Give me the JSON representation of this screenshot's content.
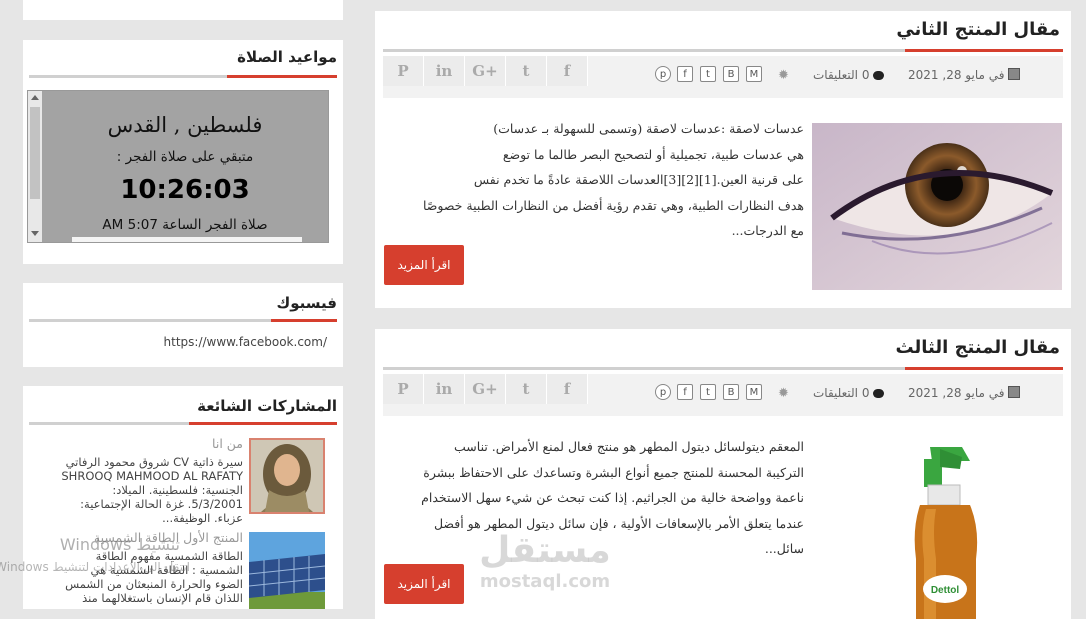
{
  "sidebar": {
    "prayer": {
      "title": "مواعيد الصلاة",
      "city": "فلسطين , القدس",
      "remaining_label": "متبقي على صلاة الفجر :",
      "countdown": "10:26:03",
      "next_prayer": "صلاة الفجر الساعة 5:07 AM"
    },
    "facebook": {
      "title": "فيسبوك",
      "link": "https://www.facebook.com/"
    },
    "popular": {
      "title": "المشاركات الشائعة",
      "items": [
        {
          "title": "من انا",
          "line1": "سيرة ذاتية CV شروق محمود الرفاتي",
          "line2": "SHROOQ MAHMOOD AL RAFATY",
          "line3": "الجنسية:   فلسطينية. الميلاد:",
          "line4": "5/3/2001.   غزة الحالة الإجتماعية:",
          "line5": "عزباء.     الوظيفة..."
        },
        {
          "title": "المنتج الأول الطاقة الشمسية",
          "line1": "الطاقة الشمسية مفهوم الطاقة",
          "line2": "الشمسية :   الطاقة الشمسية هي",
          "line3": "الضوء   والحرارة  المنبعثان  من  الشمس",
          "line4": "اللذان قام الإنسان باستغلالهما منذ"
        }
      ]
    }
  },
  "posts": [
    {
      "title": "مقال المنتج الثاني",
      "date": "في مايو 28, 2021",
      "comments": "0 التعليقات",
      "lines": [
        "عدسات لاصقة :عدسات لاصقة (وتسمى للسهولة بـ عدسات)",
        "هي عدسات طبية، تجميلية أو لتصحيح البصر طالما ما توضع",
        "على قرنية العين.[1][2][3]العدسات اللاصقة عادةً ما تخدم نفس",
        "هدف النظارات الطبية، وهي تقدم رؤية أفضل من النظارات الطبية خصوصًا",
        "مع الدرجات..."
      ],
      "read_more": "اقرأ المزيد"
    },
    {
      "title": "مقال المنتج الثالث",
      "date": "في مايو 28, 2021",
      "comments": "0 التعليقات",
      "lines": [
        "المعقم ديتولسائل ديتول المطهر هو منتج فعال لمنع الأمراض. تناسب",
        "التركيبة المحسنة للمنتج جميع أنواع البشرة وتساعدك على الاحتفاظ ببشرة",
        "ناعمة وواضحة خالية من الجراثيم. إذا كنت تبحث عن شيء سهل الاستخدام",
        "عندما يتعلق الأمر بالإسعافات الأولية ، فإن سائل ديتول المطهر هو أفضل",
        "سائل..."
      ],
      "read_more": "اقرأ المزيد",
      "product_label": "Dettol"
    }
  ],
  "share_icons": [
    "P",
    "in",
    "G+",
    "t",
    "f"
  ],
  "overlay": {
    "windows_line1": "تنشيط Windows",
    "windows_line2": "انتقل إلى الإعدادات لتنشيط Windows.",
    "watermark_ar": "مستقل",
    "watermark_en": "mostaql.com"
  }
}
